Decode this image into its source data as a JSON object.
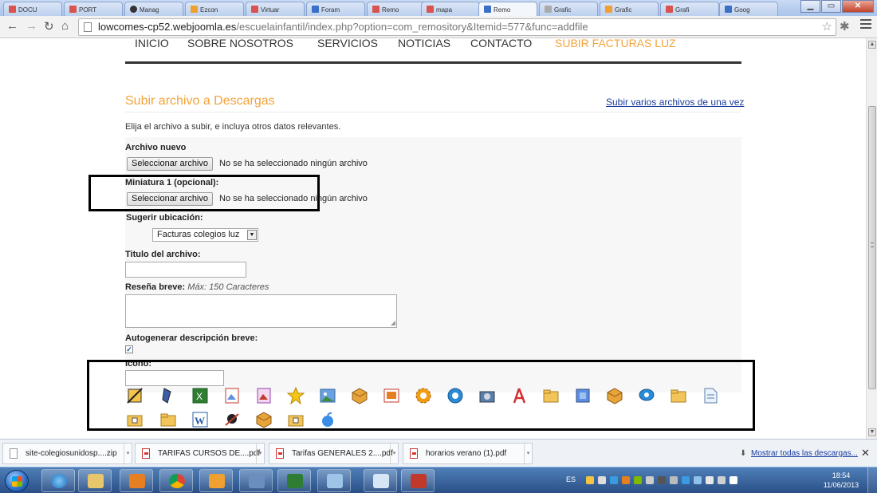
{
  "browser": {
    "tabs": [
      {
        "label": "DOCU"
      },
      {
        "label": "PORT"
      },
      {
        "label": "Manag"
      },
      {
        "label": "Ezcon"
      },
      {
        "label": "Virtuar"
      },
      {
        "label": "Foram"
      },
      {
        "label": "Remo"
      },
      {
        "label": "mapa"
      },
      {
        "label": "Remo"
      },
      {
        "label": "Grafic"
      },
      {
        "label": "Grafic"
      },
      {
        "label": "Grafi"
      },
      {
        "label": "Goog"
      }
    ],
    "url_host": "lowcomes-cp52.webjoomla.es",
    "url_path": "/escuelainfantil/index.php?option=com_remository&Itemid=577&func=addfile"
  },
  "site_nav": [
    "INICIO",
    "SOBRE NOSOTROS",
    "SERVICIOS",
    "NOTICIAS",
    "CONTACTO",
    "SUBIR FACTURAS LUZ"
  ],
  "page": {
    "heading": "Subir archivo a Descargas",
    "multi_upload_link": "Subir varios archivos de una vez",
    "intro": "Elija el archivo a subir, e incluya otros datos relevantes."
  },
  "form": {
    "new_file_label": "Archivo nuevo",
    "select_file_button": "Seleccionar archivo",
    "no_file_text": "No se ha seleccionado ningún archivo",
    "thumbnail_label": "Miniatura 1 (opcional):",
    "suggest_location_label": "Sugerir ubicación:",
    "location_value": "Facturas colegios luz",
    "title_label": "Titulo del archivo:",
    "summary_label": "Reseña breve:",
    "summary_hint": "Máx: 150 Caracteres",
    "autogen_label": "Autogenerar descripción breve:",
    "autogen_checked": true,
    "icon_label": "Icono:",
    "icon_row1": [
      "pencil-archive-icon",
      "stamp-icon",
      "excel-icon",
      "image-edit-icon",
      "image-edit-purple-icon",
      "star-icon",
      "picture-icon",
      "package-icon",
      "powerpoint-icon",
      "gear-icon",
      "quicktime-icon",
      "camera-icon",
      "acrobat-icon",
      "folder-icon",
      "archive-cube-icon",
      "package-icon",
      "chat-icon",
      "folder-icon",
      "document-icon"
    ],
    "icon_row2": [
      "folder-zip-icon",
      "folder-icon",
      "word-icon",
      "spider-icon",
      "package-icon",
      "folder-zip-icon",
      "apple-icon"
    ]
  },
  "downloads": {
    "items": [
      {
        "name": "site-colegiosunidosp....zip",
        "type": "zip"
      },
      {
        "name": "TARIFAS CURSOS DE....pdf",
        "type": "pdf"
      },
      {
        "name": "Tarifas GENERALES 2....pdf",
        "type": "pdf"
      },
      {
        "name": "horarios verano (1).pdf",
        "type": "pdf"
      }
    ],
    "show_all": "Mostrar todas las descargas...",
    "close_icon": "close-icon"
  },
  "taskbar": {
    "language": "ES",
    "time": "18:54",
    "date": "11/06/2013"
  },
  "colors": {
    "accent_orange": "#f4a33a",
    "link_blue": "#1a3c9e"
  }
}
